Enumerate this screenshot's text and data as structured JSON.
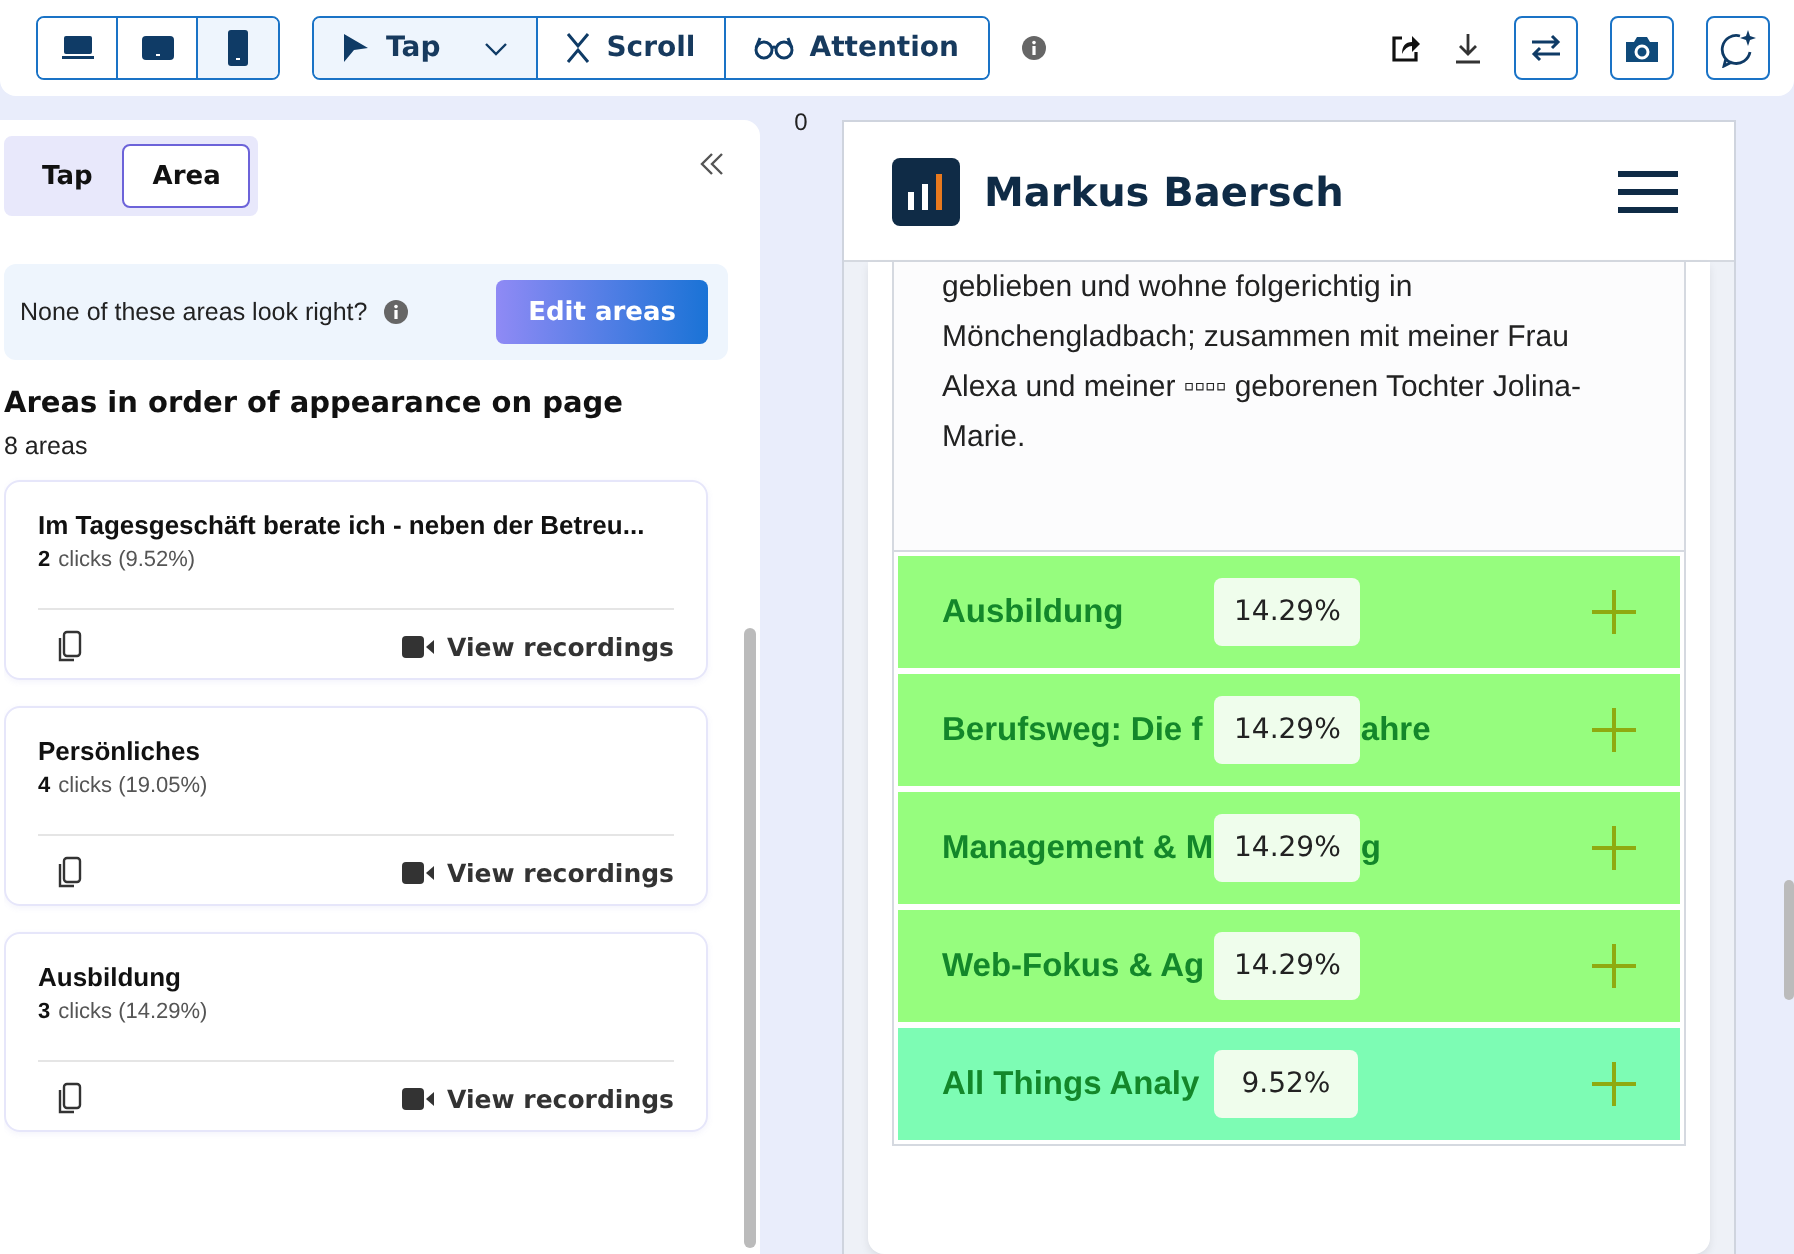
{
  "toolbar": {
    "devices": [
      {
        "kind": "desktop",
        "selected": false
      },
      {
        "kind": "tablet",
        "selected": false
      },
      {
        "kind": "mobile",
        "selected": true
      }
    ],
    "modes": [
      {
        "kind": "tap",
        "label": "Tap",
        "selected": true
      },
      {
        "kind": "scroll",
        "label": "Scroll",
        "selected": false
      },
      {
        "kind": "attention",
        "label": "Attention",
        "selected": false
      }
    ]
  },
  "sidebar": {
    "tabs": [
      {
        "label": "Tap",
        "selected": false
      },
      {
        "label": "Area",
        "selected": true
      }
    ],
    "notice": {
      "text": "None of these areas look right?",
      "button": "Edit areas"
    },
    "heading": "Areas in order of appearance on page",
    "count": "8 areas",
    "areas": [
      {
        "title": "Im Tagesgeschäft berate ich - neben der Betreu...",
        "clicks": "2",
        "detail": "clicks (9.52%)",
        "action": "View recordings"
      },
      {
        "title": "Persönliches",
        "clicks": "4",
        "detail": "clicks (19.05%)",
        "action": "View recordings"
      },
      {
        "title": "Ausbildung",
        "clicks": "3",
        "detail": "clicks (14.29%)",
        "action": "View recordings"
      }
    ]
  },
  "ruler": "0",
  "preview": {
    "brand": "Markus Baersch",
    "paragraph": "geblieben und wohne folgerichtig in Mönchengladbach; zusammen mit meiner Frau Alexa und meiner ▫▫▫▫ geborenen Tochter Jolina-Marie.",
    "sections": [
      {
        "title": "Ausbildung",
        "share": "14.29%",
        "color": "#96fd7e"
      },
      {
        "title": "Berufsweg: Die f",
        "title_end": "ahre",
        "share": "14.29%",
        "color": "#96fd7e"
      },
      {
        "title": "Management & M",
        "title_end": "g",
        "share": "14.29%",
        "color": "#96fd7e"
      },
      {
        "title": "Web-Fokus & Ag",
        "share": "14.29%",
        "color": "#96fd7e"
      },
      {
        "title": "All Things Analy",
        "share": "9.52%",
        "color": "#7dfcb4"
      }
    ]
  }
}
